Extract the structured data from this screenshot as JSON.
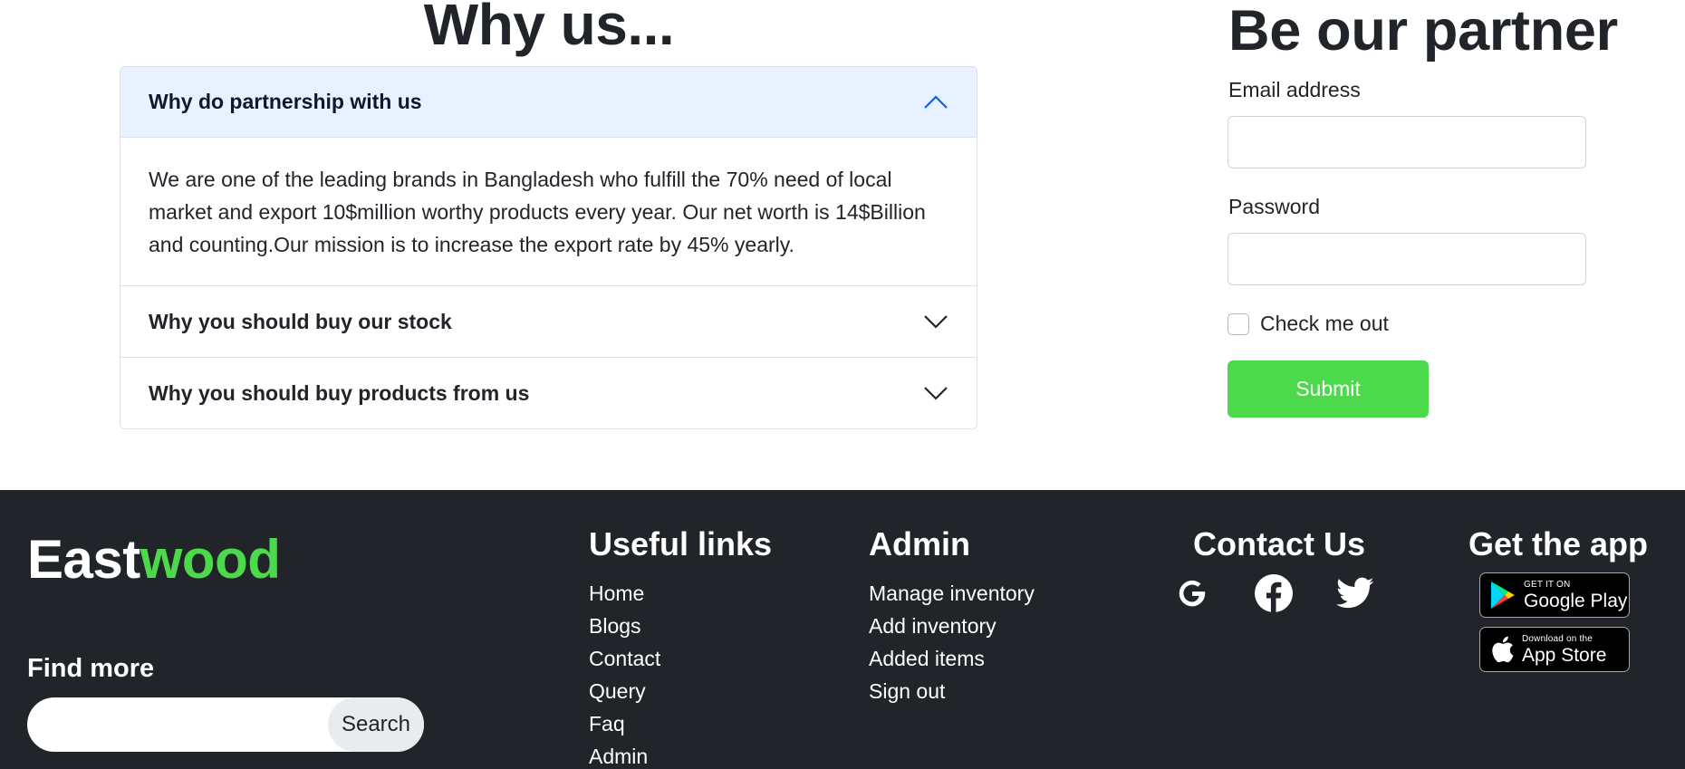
{
  "why_us": {
    "title": "Why us...",
    "items": [
      {
        "question": "Why do partnership with us",
        "answer": "We are one of the leading brands in Bangladesh who fulfill the 70% need of local market and export 10$million worthy products every year. Our net worth is 14$Billion and counting.Our mission is to increase the export rate by 45% yearly.",
        "expanded": true
      },
      {
        "question": "Why you should buy our stock",
        "expanded": false
      },
      {
        "question": "Why you should buy products from us",
        "expanded": false
      }
    ]
  },
  "partner": {
    "title": "Be our partner",
    "email_label": "Email address",
    "email_value": "",
    "password_label": "Password",
    "password_value": "",
    "checkbox_label": "Check me out",
    "checkbox_checked": false,
    "submit_label": "Submit"
  },
  "footer": {
    "brand_main": "East",
    "brand_accent": "wood",
    "find_more_label": "Find more",
    "search_value": "",
    "search_button": "Search",
    "useful_links": {
      "title": "Useful links",
      "items": [
        "Home",
        "Blogs",
        "Contact",
        "Query",
        "Faq",
        "Admin"
      ]
    },
    "admin": {
      "title": "Admin",
      "items": [
        "Manage inventory",
        "Add inventory",
        "Added items",
        "Sign out"
      ]
    },
    "contact": {
      "title": "Contact Us",
      "icons": [
        "google-icon",
        "facebook-icon",
        "twitter-icon"
      ]
    },
    "get_app": {
      "title": "Get the app",
      "google_play_small": "GET IT ON",
      "google_play_big": "Google Play",
      "app_store_small": "Download on the",
      "app_store_big": "App Store"
    }
  },
  "colors": {
    "accent_green": "#4cd94c",
    "footer_bg": "#212529",
    "accordion_open_bg": "#e7f1ff"
  }
}
